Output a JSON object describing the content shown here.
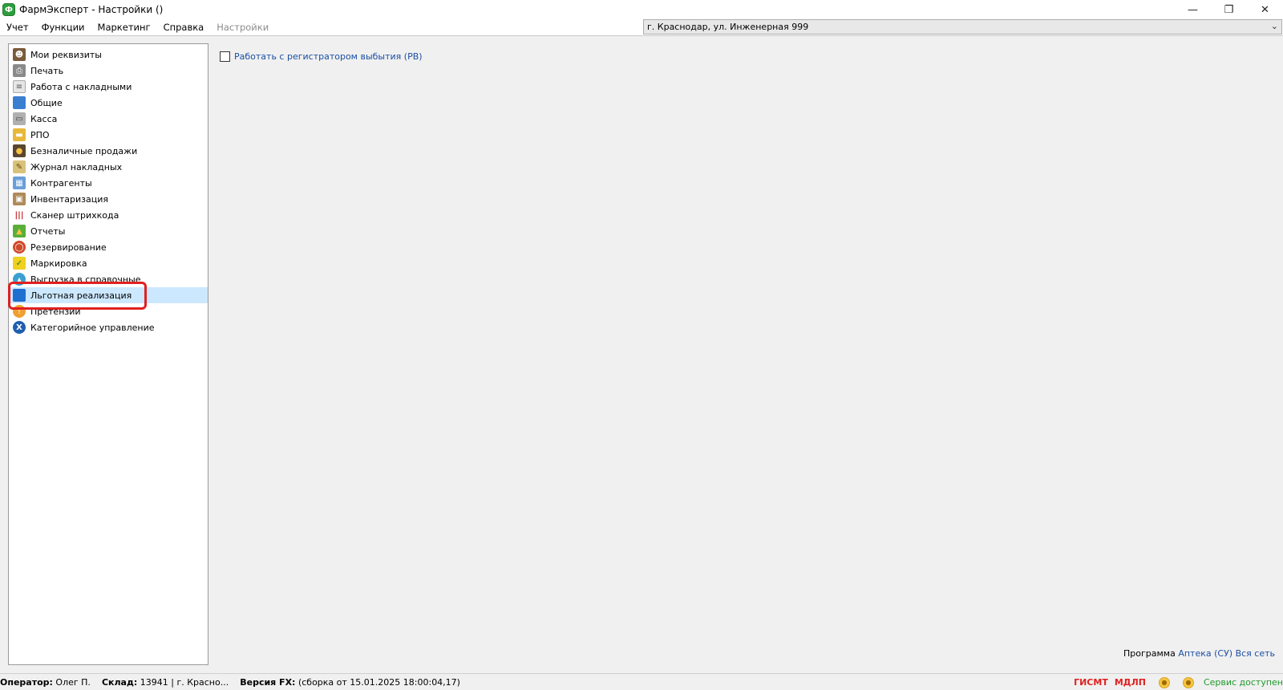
{
  "window": {
    "title": "ФармЭксперт - Настройки ()",
    "app_icon": "pharmexpert-logo-icon",
    "controls": [
      "minimize-icon",
      "restore-icon",
      "close-icon"
    ]
  },
  "menu": {
    "items": [
      {
        "label": "Учет",
        "enabled": true
      },
      {
        "label": "Функции",
        "enabled": true
      },
      {
        "label": "Маркетинг",
        "enabled": true
      },
      {
        "label": "Справка",
        "enabled": true
      },
      {
        "label": "Настройки",
        "enabled": false
      }
    ]
  },
  "store_selector": {
    "value": "г. Краснодар, ул. Инженерная 999"
  },
  "tree": {
    "items": [
      {
        "label": "Мои реквизиты",
        "icon": "user-card-icon"
      },
      {
        "label": "Печать",
        "icon": "printer-icon"
      },
      {
        "label": "Работа с накладными",
        "icon": "document-list-icon"
      },
      {
        "label": "Общие",
        "icon": "book-icon"
      },
      {
        "label": "Касса",
        "icon": "cash-register-icon"
      },
      {
        "label": "РПО",
        "icon": "rpo-icon"
      },
      {
        "label": "Безналичные продажи",
        "icon": "card-payment-icon"
      },
      {
        "label": "Журнал накладных",
        "icon": "journal-icon"
      },
      {
        "label": "Контрагенты",
        "icon": "contractors-icon"
      },
      {
        "label": "Инвентаризация",
        "icon": "inventory-boxes-icon"
      },
      {
        "label": "Сканер штрихкода",
        "icon": "barcode-icon"
      },
      {
        "label": "Отчеты",
        "icon": "reports-chart-icon"
      },
      {
        "label": "Резервирование",
        "icon": "reservation-icon"
      },
      {
        "label": "Маркировка",
        "icon": "marking-check-icon"
      },
      {
        "label": "Выгрузка в справочные",
        "icon": "upload-globe-icon"
      },
      {
        "label": "Льготная реализация",
        "icon": "preferential-book-icon",
        "selected": true
      },
      {
        "label": "Претензии",
        "icon": "claims-icon"
      },
      {
        "label": "Категорийное управление",
        "icon": "category-management-icon"
      }
    ]
  },
  "content": {
    "checkbox_label": "Работать с регистратором выбытия (РВ)",
    "checkbox_checked": false,
    "program_prefix": "Программа",
    "program_name": "Аптека (СУ)",
    "program_scope": "Вся сеть"
  },
  "status": {
    "operator_label": "Оператор:",
    "operator_value": "Олег П.",
    "warehouse_label": "Склад:",
    "warehouse_value": "13941 | г. Красно...",
    "version_label": "Версия FX:",
    "version_value": "(сборка от 15.01.2025 18:00:04,17)",
    "gismt": "ГИСМТ",
    "mdlp": "МДЛП",
    "service": "Сервис доступен"
  },
  "colors": {
    "selection": "#cce8ff",
    "highlight_border": "#e02020",
    "link_blue": "#1a4fa3",
    "status_red": "#e02020",
    "status_green": "#1f9a2c"
  }
}
